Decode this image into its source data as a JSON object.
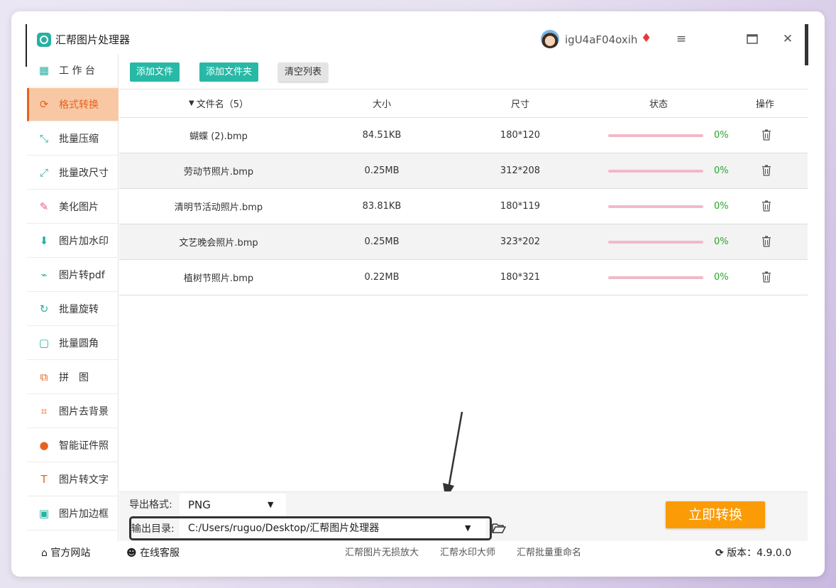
{
  "app": {
    "title": "汇帮图片处理器",
    "username": "igU4aF04oxih"
  },
  "colors": {
    "accent_teal": "#27b9a6",
    "active_orange": "#e8621e",
    "active_bg": "#f8c8a4",
    "convert_orange": "#fb9b05",
    "progress_pink": "#f2b9c8",
    "percent_green": "#2aa52a"
  },
  "window_controls": {
    "menu_icon": "hamburger-icon",
    "maximize_icon": "maximize-icon",
    "close_icon": "close-icon"
  },
  "sidebar": {
    "items": [
      {
        "label": "工 作 台",
        "icon": "grid-icon",
        "glyph": "▦"
      },
      {
        "label": "格式转换",
        "icon": "format-convert-icon",
        "glyph": "⟳",
        "active": true
      },
      {
        "label": "批量压缩",
        "icon": "compress-icon",
        "glyph": "⤡"
      },
      {
        "label": "批量改尺寸",
        "icon": "resize-icon",
        "glyph": "⤢"
      },
      {
        "label": "美化图片",
        "icon": "beautify-icon",
        "glyph": "✎"
      },
      {
        "label": "图片加水印",
        "icon": "watermark-icon",
        "glyph": "⬇"
      },
      {
        "label": "图片转pdf",
        "icon": "pdf-icon",
        "glyph": "⌁"
      },
      {
        "label": "批量旋转",
        "icon": "rotate-icon",
        "glyph": "↻"
      },
      {
        "label": "批量圆角",
        "icon": "round-corner-icon",
        "glyph": "▢"
      },
      {
        "label": "拼　图",
        "icon": "puzzle-icon",
        "glyph": "⧉"
      },
      {
        "label": "图片去背景",
        "icon": "crop-background-icon",
        "glyph": "⌗"
      },
      {
        "label": "智能证件照",
        "icon": "id-photo-icon",
        "glyph": "●"
      },
      {
        "label": "图片转文字",
        "icon": "text-icon",
        "glyph": "T"
      },
      {
        "label": "图片加边框",
        "icon": "frame-icon",
        "glyph": "▣"
      }
    ]
  },
  "toolbar": {
    "add_file": "添加文件",
    "add_folder": "添加文件夹",
    "clear_list": "清空列表"
  },
  "table": {
    "headers": {
      "name": "文件名（5）",
      "size": "大小",
      "dimensions": "尺寸",
      "status": "状态",
      "actions": "操作"
    },
    "rows": [
      {
        "name": "蝴蝶 (2).bmp",
        "size": "84.51KB",
        "dimensions": "180*120",
        "progress": "0%"
      },
      {
        "name": "劳动节照片.bmp",
        "size": "0.25MB",
        "dimensions": "312*208",
        "progress": "0%"
      },
      {
        "name": "清明节活动照片.bmp",
        "size": "83.81KB",
        "dimensions": "180*119",
        "progress": "0%"
      },
      {
        "name": "文艺晚会照片.bmp",
        "size": "0.25MB",
        "dimensions": "323*202",
        "progress": "0%"
      },
      {
        "name": "植树节照片.bmp",
        "size": "0.22MB",
        "dimensions": "180*321",
        "progress": "0%"
      }
    ]
  },
  "output": {
    "format_label": "导出格式:",
    "format_value": "PNG",
    "dir_label": "输出目录:",
    "dir_value": "C:/Users/ruguo/Desktop/汇帮图片处理器",
    "convert_button": "立即转换"
  },
  "footer": {
    "website": "官方网站",
    "support": "在线客服",
    "link1": "汇帮图片无损放大",
    "link2": "汇帮水印大师",
    "link3": "汇帮批量重命名",
    "version": "版本：4.9.0.0"
  }
}
